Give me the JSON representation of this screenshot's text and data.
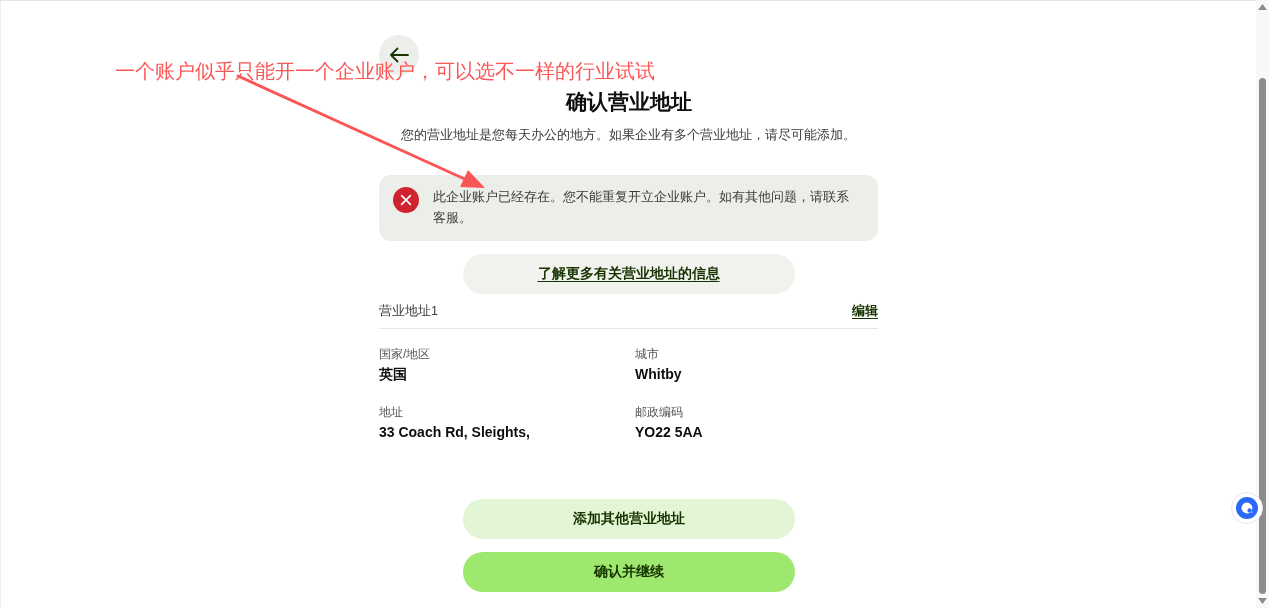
{
  "annotation": {
    "text": "一个账户似乎只能开一个企业账户，可以选不一样的行业试试"
  },
  "page": {
    "title": "确认营业地址",
    "subtitle": "您的营业地址是您每天办公的地方。如果企业有多个营业地址，请尽可能添加。"
  },
  "alert": {
    "kind": "error",
    "message": "此企业账户已经存在。您不能重复开立企业账户。如有其他问题，请联系客服。"
  },
  "info_link": "了解更多有关营业地址的信息",
  "address": {
    "title": "营业地址1",
    "edit": "编辑",
    "fields": [
      {
        "label": "国家/地区",
        "value": "英国"
      },
      {
        "label": "城市",
        "value": "Whitby"
      },
      {
        "label": "地址",
        "value": "33 Coach Rd, Sleights,"
      },
      {
        "label": "邮政编码",
        "value": "YO22 5AA"
      }
    ]
  },
  "buttons": [
    {
      "label": "添加其他营业地址",
      "kind": "secondary"
    },
    {
      "label": "确认并继续",
      "kind": "primary"
    }
  ]
}
